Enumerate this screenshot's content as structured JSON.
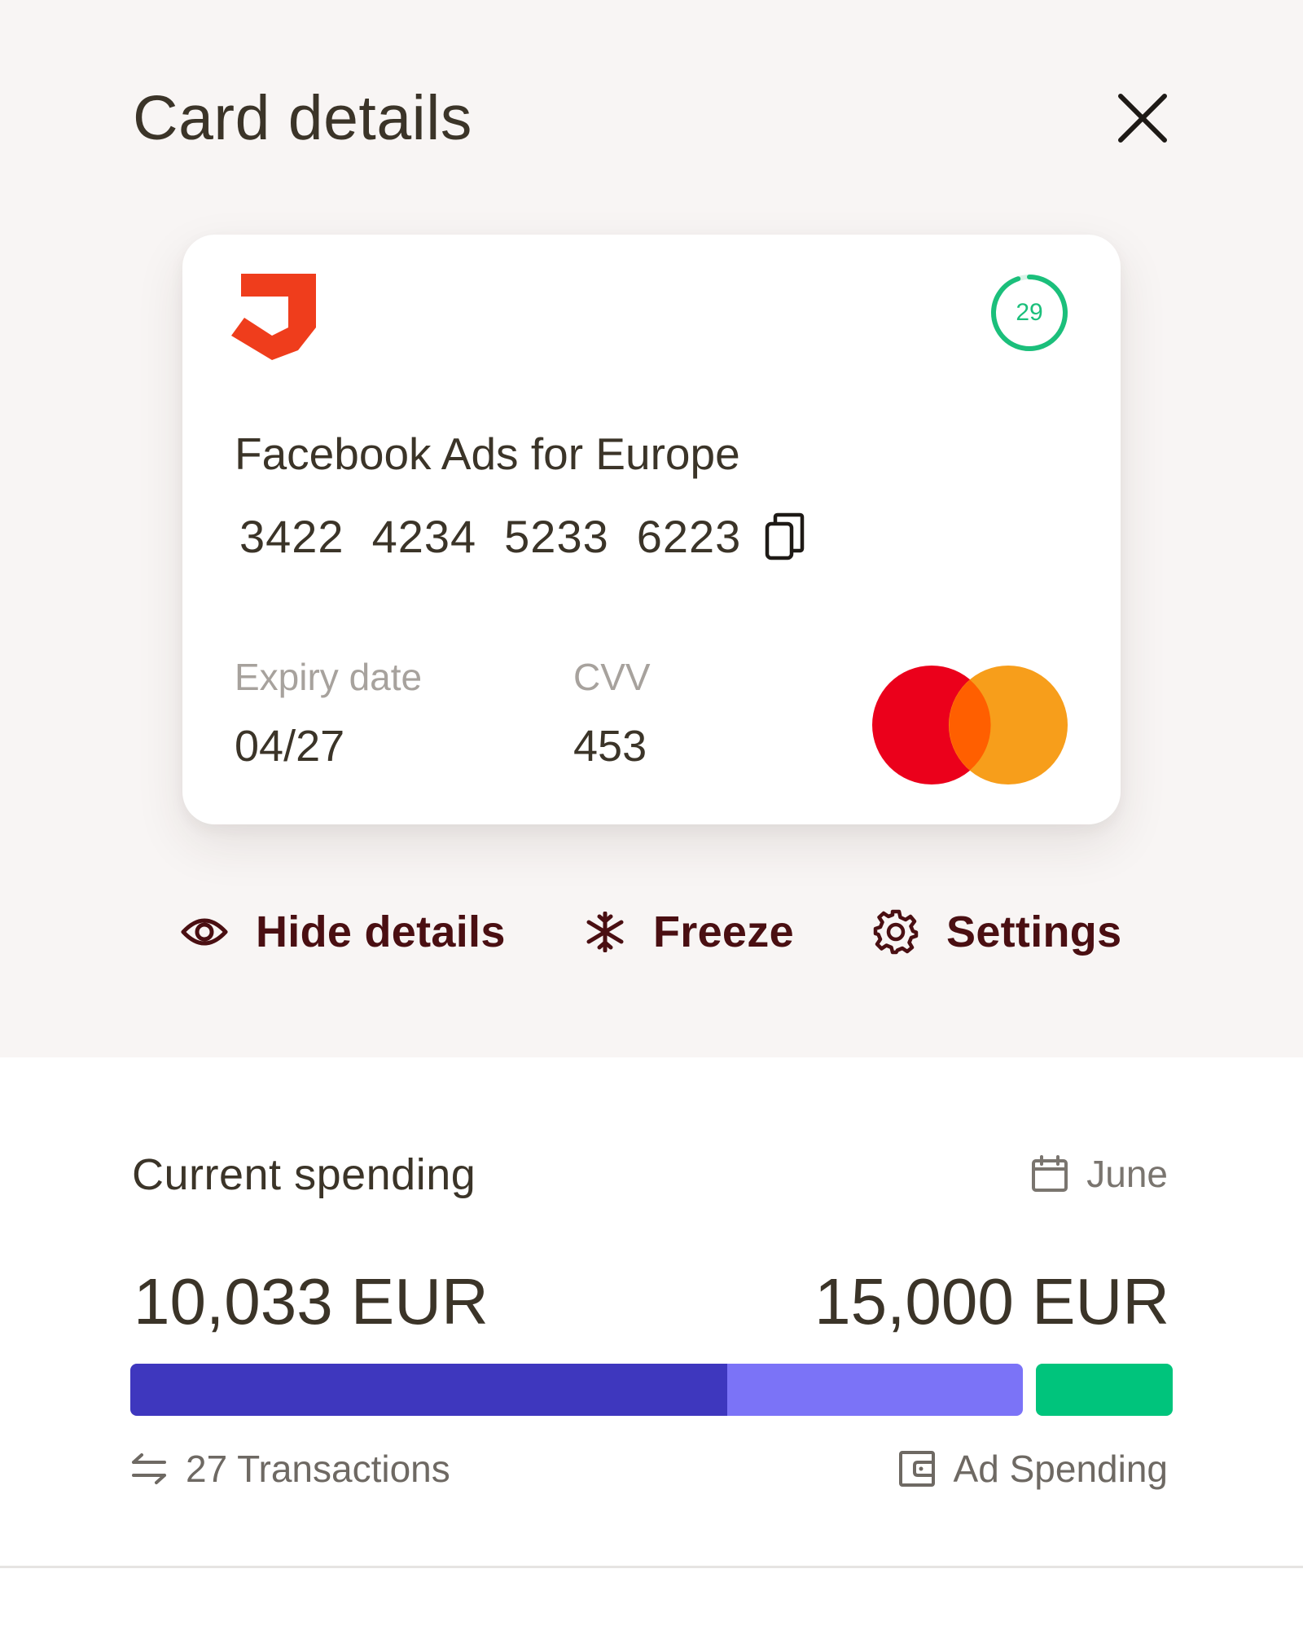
{
  "header": {
    "title": "Card details"
  },
  "card": {
    "name": "Facebook Ads for Europe",
    "number_groups": [
      "3422",
      "4234",
      "5233",
      "6223"
    ],
    "expiry_label": "Expiry date",
    "expiry_value": "04/27",
    "cvv_label": "CVV",
    "cvv_value": "453",
    "timer_value": "29",
    "brand_icon": "mastercard-logo",
    "logo_color": "#ef3d1c",
    "timer_color": "#1bbf7b"
  },
  "actions": {
    "hide_label": "Hide details",
    "freeze_label": "Freeze",
    "settings_label": "Settings"
  },
  "spending": {
    "title": "Current spending",
    "month": "June",
    "spent": "10,033 EUR",
    "limit": "15,000 EUR",
    "transactions": "27 Transactions",
    "category": "Ad Spending",
    "spent_fraction": 0.669,
    "colors": {
      "spent": "#3e37be",
      "remaining": "#7b73f7",
      "other": "#00c47c"
    }
  }
}
